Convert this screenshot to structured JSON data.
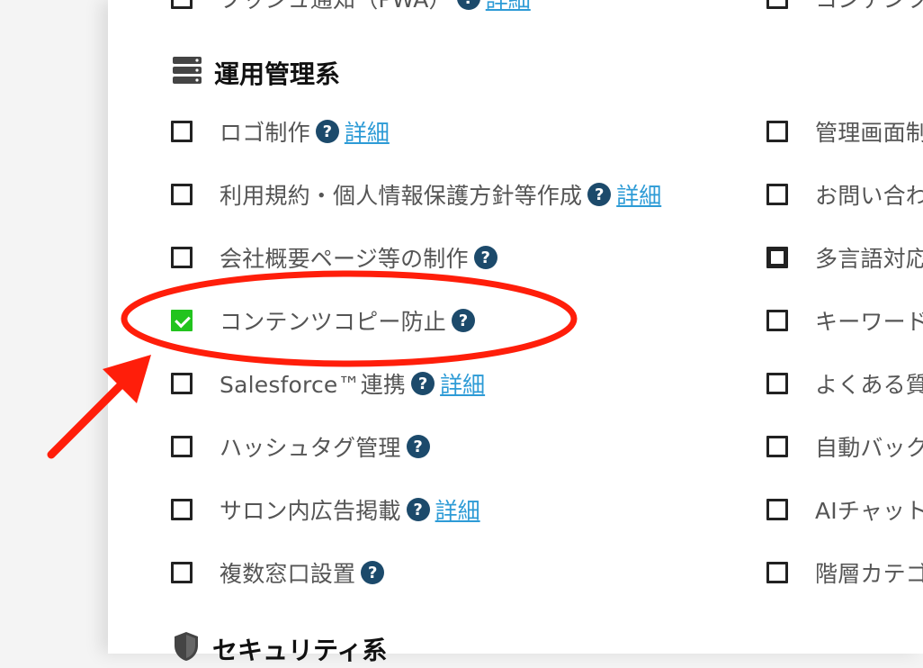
{
  "top_partial": {
    "left_label": "プッシュ通知（PWA）",
    "left_detail": "詳細",
    "right_label": "コンテンツ"
  },
  "section_ops": {
    "title": "運用管理系",
    "icon": "server-icon",
    "left_items": [
      {
        "label": "ロゴ制作",
        "help": "?",
        "detail": "詳細",
        "checked": false
      },
      {
        "label": "利用規約・個人情報保護方針等作成",
        "help": "?",
        "detail": "詳細",
        "checked": false
      },
      {
        "label": "会社概要ページ等の制作",
        "help": "?",
        "checked": false
      },
      {
        "label": "コンテンツコピー防止",
        "help": "?",
        "checked": true
      },
      {
        "label": "Salesforce™連携",
        "help": "?",
        "detail": "詳細",
        "checked": false
      },
      {
        "label": "ハッシュタグ管理",
        "help": "?",
        "checked": false
      },
      {
        "label": "サロン内広告掲載",
        "help": "?",
        "detail": "詳細",
        "checked": false
      },
      {
        "label": "複数窓口設置",
        "help": "?",
        "checked": false
      }
    ],
    "right_items": [
      {
        "label": "管理画面制",
        "checked": false
      },
      {
        "label": "お問い合わ",
        "checked": false
      },
      {
        "label": "多言語対応",
        "checked": false
      },
      {
        "label": "キーワード",
        "checked": false
      },
      {
        "label": "よくある質",
        "checked": false
      },
      {
        "label": "自動バック",
        "checked": false
      },
      {
        "label": "AIチャット",
        "checked": false
      },
      {
        "label": "階層カテゴ",
        "checked": false
      }
    ]
  },
  "section_security": {
    "title": "セキュリティ系",
    "icon": "shield-icon"
  },
  "colors": {
    "checked": "#22c41e",
    "help_icon": "#1c4a6b",
    "link": "#2d9bd6",
    "annotation": "#ff1e0a"
  }
}
